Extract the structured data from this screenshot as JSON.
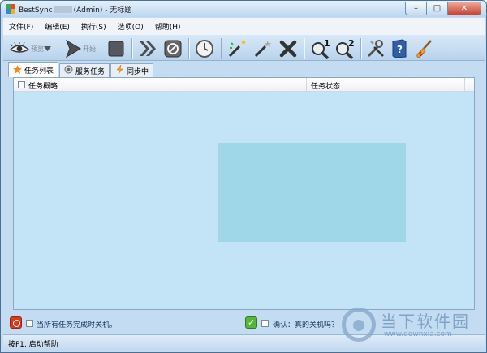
{
  "window": {
    "title_prefix": "BestSync",
    "title_suffix": "(Admin) - 无标题",
    "minimize": "–",
    "maximize": "□",
    "close": "✕"
  },
  "menu": [
    {
      "label": "文件(F)"
    },
    {
      "label": "编辑(E)"
    },
    {
      "label": "执行(S)"
    },
    {
      "label": "选项(O)"
    },
    {
      "label": "帮助(H)"
    }
  ],
  "toolbar": {
    "preview_label": "预览",
    "start_label": "开始",
    "items": [
      {
        "icon": "eye-icon"
      },
      {
        "icon": "play-icon"
      },
      {
        "icon": "stop-icon"
      },
      {
        "icon": "fast-forward-icon"
      },
      {
        "icon": "cancel-icon"
      },
      {
        "icon": "clock-icon"
      },
      {
        "icon": "new-task-wand-icon"
      },
      {
        "icon": "edit-task-wand-icon"
      },
      {
        "icon": "delete-icon"
      },
      {
        "icon": "search-1-icon"
      },
      {
        "icon": "search-2-icon"
      },
      {
        "icon": "tools-icon"
      },
      {
        "icon": "help-book-icon"
      },
      {
        "icon": "broom-icon"
      }
    ]
  },
  "tabs": [
    {
      "label": "任务列表",
      "icon": "star-icon",
      "active": true
    },
    {
      "label": "服务任务",
      "icon": "service-icon",
      "active": false
    },
    {
      "label": "同步中",
      "icon": "sync-icon",
      "active": false
    }
  ],
  "table": {
    "columns": [
      "任务概略",
      "任务状态"
    ],
    "rows": []
  },
  "bottom": {
    "shutdown_label": "当所有任务完成时关机。",
    "confirm_label": "确认：真的关机吗？"
  },
  "status": {
    "text": "按F1, 启动帮助"
  },
  "watermark": {
    "title": "当下软件园",
    "url": "www.downxia.com"
  },
  "colors": {
    "panel_bg": "#c3e4f7",
    "selection": "#9fd7e9",
    "window_frame": "#c3dcf1"
  }
}
